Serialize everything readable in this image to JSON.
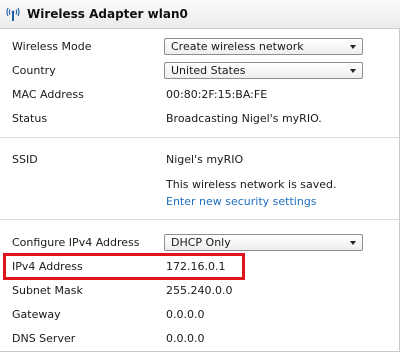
{
  "header": {
    "title": "Wireless Adapter wlan0",
    "icon": "wireless-antenna-icon"
  },
  "general": {
    "wireless_mode_label": "Wireless Mode",
    "wireless_mode_value": "Create wireless network",
    "country_label": "Country",
    "country_value": "United States",
    "mac_label": "MAC Address",
    "mac_value": "00:80:2F:15:BA:FE",
    "status_label": "Status",
    "status_value": "Broadcasting Nigel's myRIO."
  },
  "network": {
    "ssid_label": "SSID",
    "ssid_value": "Nigel's myRIO",
    "saved_note": "This wireless network is saved.",
    "security_link": "Enter new security settings"
  },
  "ipv4": {
    "configure_label": "Configure IPv4 Address",
    "configure_value": "DHCP Only",
    "address_label": "IPv4 Address",
    "address_value": "172.16.0.1",
    "subnet_label": "Subnet Mask",
    "subnet_value": "255.240.0.0",
    "gateway_label": "Gateway",
    "gateway_value": "0.0.0.0",
    "dns_label": "DNS Server",
    "dns_value": "0.0.0.0"
  },
  "colors": {
    "highlight": "#e0141c",
    "link": "#1f6fc1"
  }
}
